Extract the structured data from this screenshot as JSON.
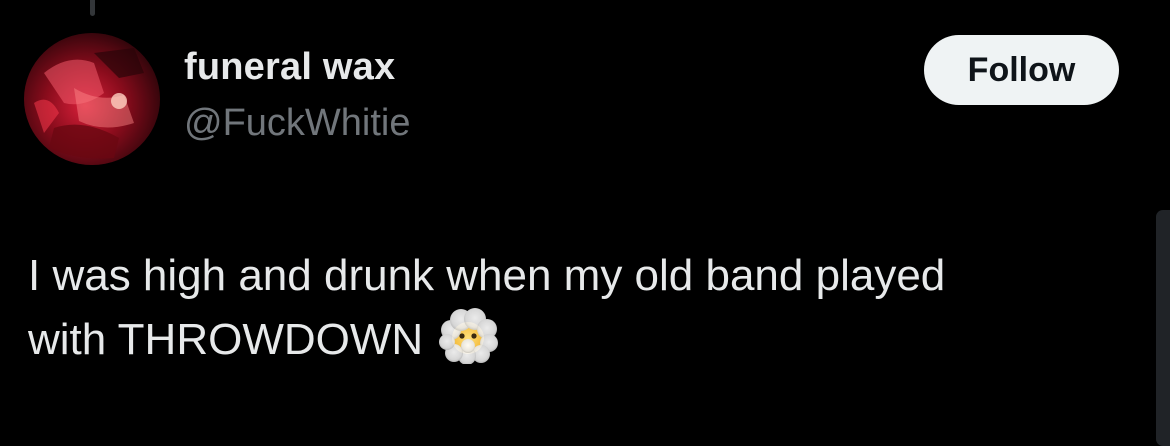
{
  "tweet": {
    "author": {
      "display_name": "funeral wax",
      "handle": "@FuckWhitie",
      "avatar_icon": "band-photo-avatar"
    },
    "follow_label": "Follow",
    "text_line_1": "I was high and drunk when my old band played",
    "text_line_2": "with THROWDOWN",
    "emoji_icon": "face-in-clouds-emoji"
  },
  "colors": {
    "background": "#000000",
    "primary_text": "#e7e9ea",
    "secondary_text": "#71767b",
    "follow_button_bg": "#eff3f4",
    "follow_button_text": "#0f1419",
    "avatar_accent": "#c0142a"
  }
}
